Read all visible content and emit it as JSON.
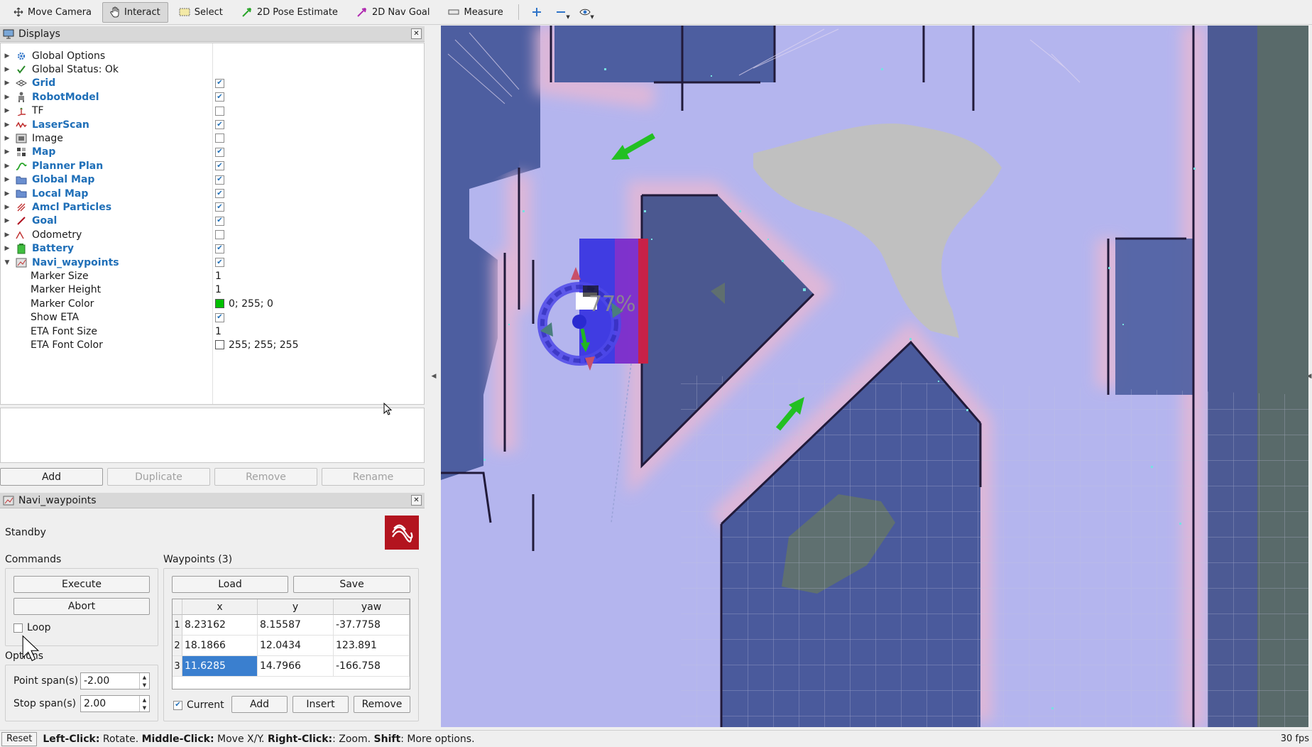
{
  "toolbar": {
    "tools": [
      {
        "label": "Move Camera",
        "icon": "move-camera-icon",
        "active": false
      },
      {
        "label": "Interact",
        "icon": "hand-icon",
        "active": true
      },
      {
        "label": "Select",
        "icon": "select-icon",
        "active": false
      },
      {
        "label": "2D Pose Estimate",
        "icon": "green-arrow-icon",
        "active": false
      },
      {
        "label": "2D Nav Goal",
        "icon": "magenta-arrow-icon",
        "active": false
      },
      {
        "label": "Measure",
        "icon": "ruler-icon",
        "active": false
      }
    ]
  },
  "displays": {
    "title": "Displays",
    "items": [
      {
        "label": "Global Options",
        "icon": "gear-icon",
        "bold": false,
        "checked": null
      },
      {
        "label": "Global Status: Ok",
        "icon": "check-icon",
        "bold": false,
        "checked": null
      },
      {
        "label": "Grid",
        "icon": "grid-icon",
        "bold": true,
        "checked": true
      },
      {
        "label": "RobotModel",
        "icon": "robot-icon",
        "bold": true,
        "checked": true
      },
      {
        "label": "TF",
        "icon": "tf-icon",
        "bold": false,
        "checked": false
      },
      {
        "label": "LaserScan",
        "icon": "laser-icon",
        "bold": true,
        "checked": true
      },
      {
        "label": "Image",
        "icon": "image-icon",
        "bold": false,
        "checked": false
      },
      {
        "label": "Map",
        "icon": "map-icon",
        "bold": true,
        "checked": true
      },
      {
        "label": "Planner Plan",
        "icon": "path-icon",
        "bold": true,
        "checked": true
      },
      {
        "label": "Global Map",
        "icon": "folder-icon",
        "bold": true,
        "checked": true
      },
      {
        "label": "Local Map",
        "icon": "folder-icon",
        "bold": true,
        "checked": true
      },
      {
        "label": "Amcl Particles",
        "icon": "particles-icon",
        "bold": true,
        "checked": true
      },
      {
        "label": "Goal",
        "icon": "goal-icon",
        "bold": true,
        "checked": true
      },
      {
        "label": "Odometry",
        "icon": "odometry-icon",
        "bold": false,
        "checked": false
      },
      {
        "label": "Battery",
        "icon": "battery-icon",
        "bold": true,
        "checked": true
      },
      {
        "label": "Navi_waypoints",
        "icon": "waypoints-icon",
        "bold": true,
        "checked": true,
        "expanded": true
      }
    ],
    "properties": [
      {
        "label": "Marker Size",
        "value": "1"
      },
      {
        "label": "Marker Height",
        "value": "1"
      },
      {
        "label": "Marker Color",
        "value": "0; 255; 0",
        "swatch": "#00c000"
      },
      {
        "label": "Show ETA",
        "checkbox": true
      },
      {
        "label": "ETA Font Size",
        "value": "1"
      },
      {
        "label": "ETA Font Color",
        "value": "255; 255; 255",
        "swatch": "#ffffff"
      }
    ],
    "buttons": {
      "add": "Add",
      "duplicate": "Duplicate",
      "remove": "Remove",
      "rename": "Rename"
    }
  },
  "navi": {
    "title": "Navi_waypoints",
    "status": "Standby",
    "commands_title": "Commands",
    "execute": "Execute",
    "abort": "Abort",
    "loop": "Loop",
    "options_title": "Options",
    "point_span_label": "Point span(s)",
    "point_span_value": "-2.00",
    "stop_span_label": "Stop span(s)",
    "stop_span_value": "2.00",
    "waypoints_title": "Waypoints (3)",
    "load": "Load",
    "save": "Save",
    "columns": [
      "x",
      "y",
      "yaw"
    ],
    "rows": [
      {
        "n": "1",
        "x": "8.23162",
        "y": "8.15587",
        "yaw": "-37.7758"
      },
      {
        "n": "2",
        "x": "18.1866",
        "y": "12.0434",
        "yaw": "123.891"
      },
      {
        "n": "3",
        "x": "11.6285",
        "y": "14.7966",
        "yaw": "-166.758"
      }
    ],
    "current": "Current",
    "add": "Add",
    "insert": "Insert",
    "remove": "Remove"
  },
  "view": {
    "eta_text": "77%"
  },
  "status": {
    "reset": "Reset",
    "help": [
      {
        "key": "Left-Click:",
        "desc": " Rotate. "
      },
      {
        "key": "Middle-Click:",
        "desc": " Move X/Y. "
      },
      {
        "key": "Right-Click:",
        "desc": ": Zoom. "
      },
      {
        "key": "Shift",
        "desc": ": More options."
      }
    ],
    "fps": "30 fps"
  }
}
